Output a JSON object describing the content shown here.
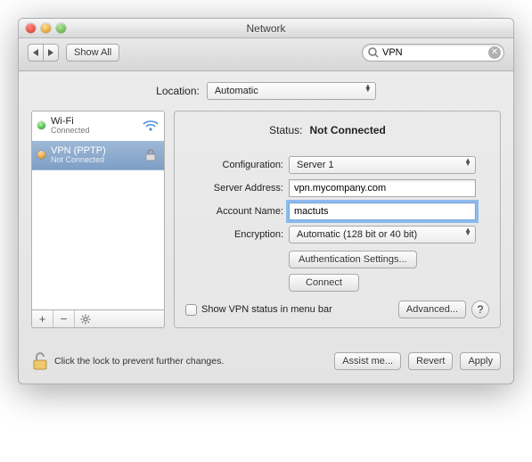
{
  "window": {
    "title": "Network"
  },
  "toolbar": {
    "showAll": "Show All",
    "search": "VPN"
  },
  "location": {
    "label": "Location:",
    "value": "Automatic"
  },
  "sidebar": {
    "items": [
      {
        "name": "Wi-Fi",
        "status": "Connected"
      },
      {
        "name": "VPN (PPTP)",
        "status": "Not Connected"
      }
    ]
  },
  "main": {
    "statusLabel": "Status:",
    "statusValue": "Not Connected",
    "configLabel": "Configuration:",
    "configValue": "Server 1",
    "serverLabel": "Server Address:",
    "serverValue": "vpn.mycompany.com",
    "accountLabel": "Account Name:",
    "accountValue": "mactuts",
    "encryptionLabel": "Encryption:",
    "encryptionValue": "Automatic (128 bit or 40 bit)",
    "authBtn": "Authentication Settings...",
    "connectBtn": "Connect",
    "showMenuBar": "Show VPN status in menu bar",
    "advancedBtn": "Advanced..."
  },
  "footer": {
    "lockText": "Click the lock to prevent further changes.",
    "assist": "Assist me...",
    "revert": "Revert",
    "apply": "Apply"
  }
}
